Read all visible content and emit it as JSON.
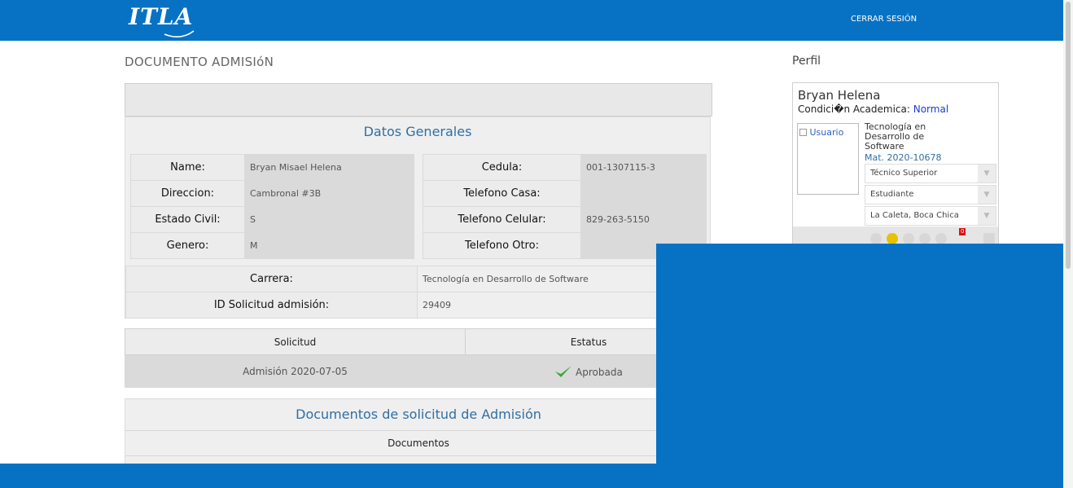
{
  "header": {
    "logo_text": "ITLA",
    "logout_label": "CERRAR SESIÓN",
    "brand_color": "#0772c4"
  },
  "page": {
    "title": "DOCUMENTO ADMISIóN"
  },
  "datos_generales": {
    "title": "Datos Generales",
    "left_rows": [
      {
        "label": "Name:",
        "value": "Bryan Misael Helena"
      },
      {
        "label": "Direccion:",
        "value": "Cambronal #3B"
      },
      {
        "label": "Estado Civil:",
        "value": "S"
      },
      {
        "label": "Genero:",
        "value": "M"
      }
    ],
    "right_rows": [
      {
        "label": "Cedula:",
        "value": "001-1307115-3"
      },
      {
        "label": "Telefono Casa:",
        "value": ""
      },
      {
        "label": "Telefono Celular:",
        "value": "829-263-5150"
      },
      {
        "label": "Telefono Otro:",
        "value": ""
      }
    ],
    "carrera_label": "Carrera:",
    "carrera_value": "Tecnología en Desarrollo de Software",
    "id_label": "ID Solicitud admisión:",
    "id_value": "29409"
  },
  "solicitud": {
    "col_solicitud": "Solicitud",
    "col_estatus": "Estatus",
    "solicitud_value": "Admisión 2020-07-05",
    "estatus_value": "Aprobada",
    "estatus_icon": "checkmark-icon"
  },
  "documentos": {
    "title": "Documentos de solicitud de Admisión",
    "subheader": "Documentos"
  },
  "profile": {
    "section_title": "Perfil",
    "name": "Bryan Helena",
    "condition_label": "Condici�n Academica:",
    "condition_value": "Normal",
    "photo_alt": "Usuario",
    "career": "Tecnología en Desarrollo de Software",
    "matricula": "Mat. 2020-10678",
    "selects": [
      "Técnico Superior",
      "Estudiante",
      "La Caleta, Boca Chica"
    ],
    "notification_count": "0"
  }
}
